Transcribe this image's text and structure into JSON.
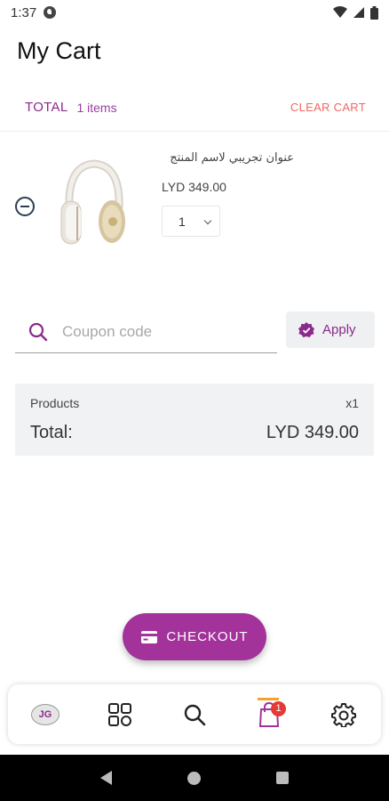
{
  "status": {
    "time": "1:37"
  },
  "header": {
    "title": "My Cart"
  },
  "cart": {
    "total_label": "TOTAL",
    "items_count": "1 items",
    "clear_label": "CLEAR CART",
    "items": [
      {
        "title": "عنوان تجريبي لاسم المنتج",
        "price": "LYD 349.00",
        "quantity": "1",
        "image_icon": "headphones"
      }
    ]
  },
  "coupon": {
    "placeholder": "Coupon code",
    "apply_label": "Apply"
  },
  "summary": {
    "products_label": "Products",
    "products_qty": "x1",
    "total_label": "Total:",
    "total_value": "LYD 349.00"
  },
  "checkout": {
    "label": "CHECKOUT"
  },
  "bottom_nav": {
    "logo_text": "JG",
    "cart_badge": "1"
  },
  "colors": {
    "accent": "#a3339b",
    "clear": "#ef6a62",
    "badge": "#e53935",
    "indicator": "#f5a12a"
  }
}
